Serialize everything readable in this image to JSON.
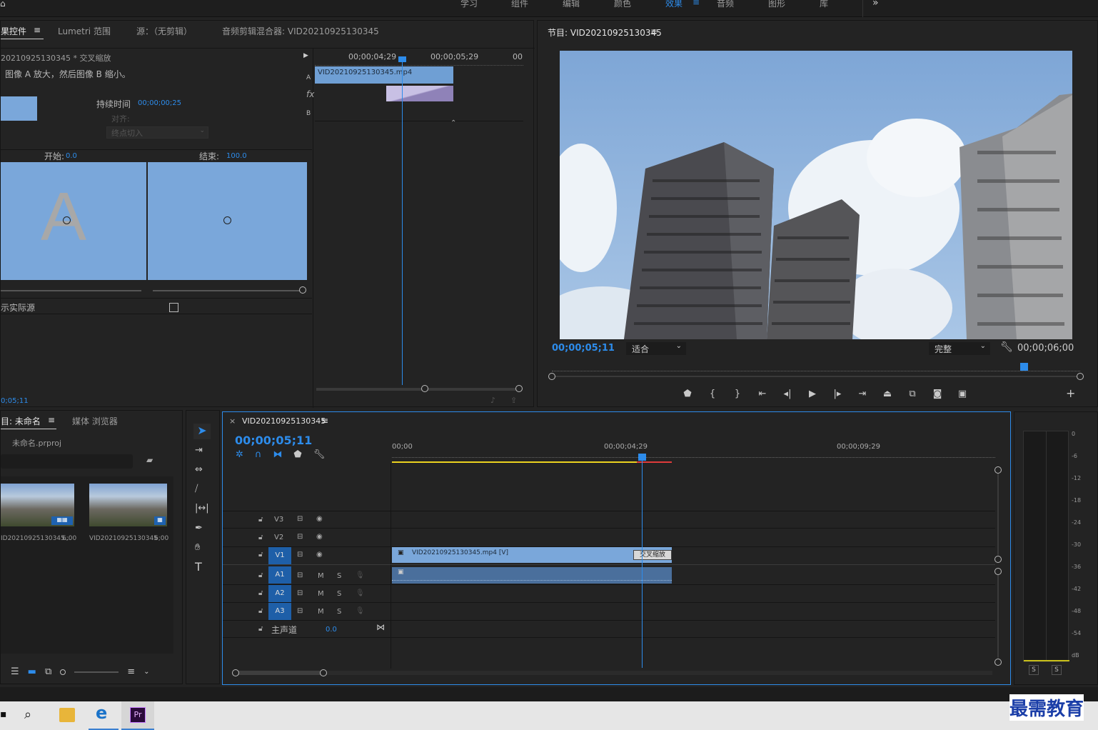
{
  "workspaces": [
    "学习",
    "组件",
    "编辑",
    "颜色",
    "效果",
    "音频",
    "图形",
    "库"
  ],
  "active_workspace": "效果",
  "more_workspaces": "»",
  "effect_controls": {
    "tabs": [
      "果控件",
      "Lumetri 范围",
      "源：（无剪辑）",
      "音频剪辑混合器: VID20210925130345"
    ],
    "clip_title": "20210925130345 * 交叉缩放",
    "description": "图像 A 放大，然后图像 B 缩小。",
    "duration_label": "持续时间",
    "duration_value": "00;00;00;25",
    "align_label": "对齐:",
    "align_value": "终点切入",
    "start_label": "开始:",
    "start_value": "0.0",
    "end_label": "结束:",
    "end_value": "100.0",
    "preview_a_letter": "A",
    "show_actual_sources": "示实际源",
    "timecode": "0;05;11",
    "mini_timeline": {
      "time_a": "00;00;04;29",
      "time_b": "00;00;05;29",
      "time_c": "00",
      "clip_label": "VID20210925130345.mp4",
      "track_a": "A",
      "track_b": "B",
      "fx": "fx"
    }
  },
  "program_monitor": {
    "title": "节目: VID20210925130345",
    "timecode": "00;00;05;11",
    "fit": "适合",
    "quality": "完整",
    "duration": "00;00;06;00",
    "playhead_fraction": 0.92
  },
  "project": {
    "tabs": [
      "目: 未命名",
      "媒体 浏览器"
    ],
    "project_file": "未命名.prproj",
    "items": [
      {
        "name": "ID20210925130345...",
        "duration": "6;00"
      },
      {
        "name": "VID20210925130345",
        "duration": "6;00"
      }
    ]
  },
  "timeline": {
    "sequence_name": "VID20210925130345",
    "timecode": "00;00;05;11",
    "ruler": [
      "00;00",
      "00;00;04;29",
      "00;00;09;29"
    ],
    "video_tracks": [
      "V3",
      "V2",
      "V1"
    ],
    "audio_tracks": [
      "A1",
      "A2",
      "A3"
    ],
    "master_label": "主声道",
    "master_value": "0.0",
    "mute_label": "M",
    "solo_label": "S",
    "clip_name": "VID20210925130345.mp4 [V]",
    "transition_name": "交叉缩放"
  },
  "audio_meter": {
    "scale": [
      "0",
      "-6",
      "-12",
      "-18",
      "-24",
      "-30",
      "-36",
      "-42",
      "-48",
      "-54",
      "dB"
    ],
    "solo_buttons": [
      "S",
      "S"
    ]
  },
  "watermark": "最需教育",
  "colors": {
    "accent": "#2d8ceb",
    "clip_video": "#7aa7da",
    "clip_audio": "#4a6f9c",
    "in_out": "#ecd21f",
    "render_red": "#e03b3b"
  }
}
